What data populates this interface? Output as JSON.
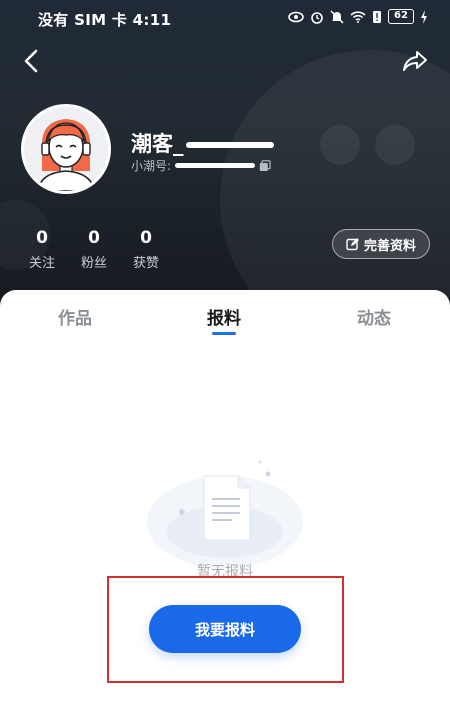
{
  "status_bar": {
    "carrier_time": "没有 SIM 卡 4:11",
    "battery": "62",
    "icons": [
      "eye-icon",
      "alarm-icon",
      "mute-icon",
      "wifi-icon",
      "sim-alert-icon",
      "battery-icon",
      "charging-icon"
    ]
  },
  "nav": {
    "back_icon": "back-arrow-icon",
    "share_icon": "share-icon"
  },
  "profile": {
    "username": "潮客_",
    "user_id_label": "小潮号:",
    "copy_icon": "copy-icon"
  },
  "stats": [
    {
      "value": "0",
      "label": "关注"
    },
    {
      "value": "0",
      "label": "粉丝"
    },
    {
      "value": "0",
      "label": "获赞"
    }
  ],
  "edit_profile": {
    "label": "完善资料",
    "icon": "edit-icon"
  },
  "tabs": [
    {
      "label": "作品",
      "active": false
    },
    {
      "label": "报料",
      "active": true
    },
    {
      "label": "动态",
      "active": false
    }
  ],
  "empty_state": {
    "text": "暂无报料",
    "icon": "document-icon"
  },
  "report_button": {
    "label": "我要报料"
  },
  "colors": {
    "accent": "#1a69e8",
    "highlight": "#d32f2f",
    "header_bg": "#1f2a36"
  }
}
